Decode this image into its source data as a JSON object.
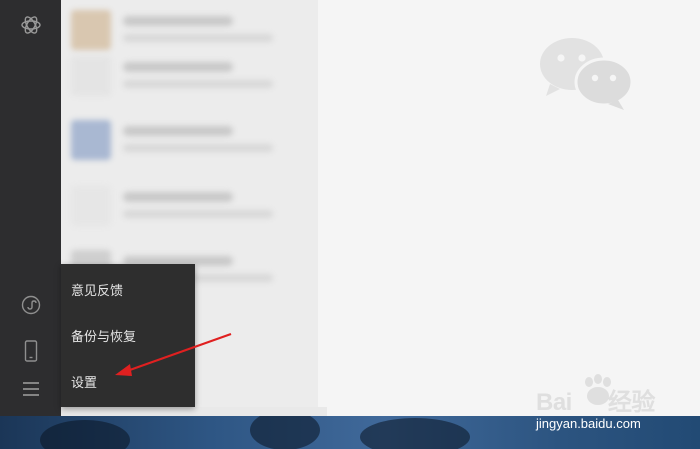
{
  "sidebar": {
    "icons": [
      "app-logo-icon",
      "mini-program-icon",
      "phone-icon",
      "menu-icon"
    ]
  },
  "menu": {
    "items": [
      {
        "label": "意见反馈"
      },
      {
        "label": "备份与恢复"
      },
      {
        "label": "设置"
      }
    ]
  },
  "watermark": {
    "brand_left": "Bai",
    "brand_right": "经验",
    "url": "jingyan.baidu.com"
  },
  "colors": {
    "sidebar": "#2d2d2f",
    "menu_bg": "#2e2e2e",
    "main_bg": "#f5f5f5",
    "annotation_arrow": "#e02020"
  }
}
